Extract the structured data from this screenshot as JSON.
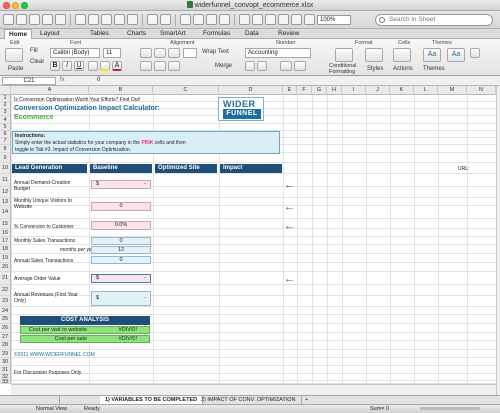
{
  "window": {
    "title": "widerfunnel_convopt_ecommerce.xlsx"
  },
  "toolbar": {
    "zoom": "100%",
    "search_placeholder": "Search in Sheet"
  },
  "ribbon_tabs": [
    "Home",
    "Layout",
    "Tables",
    "Charts",
    "SmartArt",
    "Formulas",
    "Data",
    "Review"
  ],
  "ribbon": {
    "groups": [
      "Edit",
      "Font",
      "Alignment",
      "Number",
      "Format",
      "Cells",
      "Themes"
    ],
    "paste": "Paste",
    "fill": "Fill",
    "clear": "Clear",
    "font_name": "Calibri (Body)",
    "font_size": "11",
    "wrap_text": "Wrap Text",
    "merge": "Merge",
    "number_format": "Accounting",
    "conditional": "Conditional Formatting",
    "styles": "Styles",
    "actions": "Actions",
    "themes": "Themes",
    "aa": "Aa"
  },
  "formula_bar": {
    "cell": "C21",
    "fx": "fx",
    "value": "0"
  },
  "columns": [
    "A",
    "B",
    "C",
    "D",
    "E",
    "F",
    "G",
    "H",
    "I",
    "J",
    "K",
    "L",
    "M",
    "N"
  ],
  "rows": [
    "1",
    "2",
    "3",
    "4",
    "5",
    "6",
    "7",
    "8",
    "9",
    "10",
    "11",
    "12",
    "13",
    "14",
    "15",
    "16",
    "17",
    "18",
    "19",
    "20",
    "21",
    "22",
    "23",
    "24",
    "25",
    "26",
    "27",
    "28",
    "29",
    "30",
    "31",
    "32",
    "33",
    "34",
    "35"
  ],
  "sheet": {
    "r1": "Is Conversion Optimization Worth Your Efforts? Find Out!",
    "title1": "Conversion Optimization Impact Calculator:",
    "title2": "Ecommerce",
    "instr_head": "Instructions:",
    "instr_line1a": "Simply enter the actual statistics for your company in the ",
    "instr_pink": "PINK",
    "instr_line1b": " cells and then",
    "instr_line2": "toggle to Tab #2. Impact of Conversion Optimization.",
    "hdr_lead": "Lead Generation",
    "hdr_baseline": "Baseline",
    "hdr_optimized": "Optimized Site",
    "hdr_impact": "Impact",
    "url_label": "URL:",
    "annual_demand": "Annual Demand-Creation Budget",
    "monthly_visitors": "Monthly Unique Visitors to Website",
    "pct_conversion": "% Conversion to Customer",
    "monthly_trans": "Monthly Sales Transactions",
    "months_per_year": "months per year",
    "annual_trans": "Annual Sales Transactions",
    "aov": "Average Order Value",
    "annual_rev": "Annual Revenues (First Year Only)",
    "val_demand_sym": "$",
    "val_demand": "-",
    "val_visitors": "0",
    "val_pct": "0.0%",
    "val_monthly": "0",
    "val_months": "12",
    "val_annual": "0",
    "val_aov_sym": "$",
    "val_aov": "-",
    "val_rev_sym": "$",
    "val_rev": "-",
    "cost_analysis": "COST ANALYSIS",
    "cost_visitor": "Cost per visit to website",
    "cost_visitor_val": "#DIV/0!",
    "cost_sale": "Cost per sale",
    "cost_sale_val": "#DIV/0!",
    "copyright": "©2011  WWW.WIDERFUNNEL.COM",
    "discussion": "For Discussion Purposes Only"
  },
  "logo": {
    "top": "WIDER",
    "bottom": "FUNNEL"
  },
  "sheet_tabs": [
    "1) VARIABLES TO BE COMPLETED",
    "2) IMPACT OF CONV. OPTIMIZATION"
  ],
  "status": {
    "view": "Normal View",
    "ready": "Ready",
    "sum": "Sum= 0"
  },
  "colors": {
    "header_blue": "#1f4e79",
    "pink": "#fbe3ee",
    "green": "#8fe37f",
    "arrow_red": "#d21f3c"
  }
}
